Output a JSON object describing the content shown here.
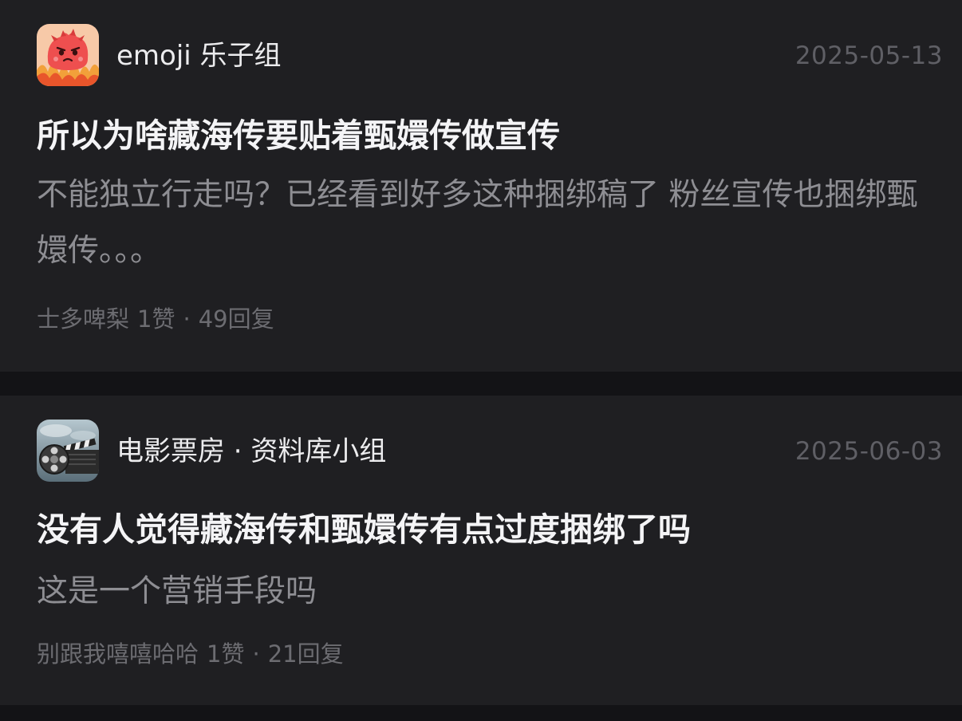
{
  "posts": [
    {
      "group": "emoji 乐子组",
      "avatar_icon": "red-fire-monster-icon",
      "date": "2025-05-13",
      "title": "所以为啥藏海传要贴着甄嬛传做宣传",
      "body": "不能独立行走吗？已经看到好多这种捆绑稿了 粉丝宣传也捆绑甄嬛传。。。",
      "author": "士多啤梨",
      "likes": "1赞",
      "separator": "·",
      "replies": "49回复"
    },
    {
      "group": "电影票房 · 资料库小组",
      "avatar_icon": "film-reel-clapperboard-icon",
      "date": "2025-06-03",
      "title": "没有人觉得藏海传和甄嬛传有点过度捆绑了吗",
      "body": "这是一个营销手段吗",
      "author": "别跟我嘻嘻哈哈",
      "likes": "1赞",
      "separator": "·",
      "replies": "21回复"
    }
  ],
  "colors": {
    "background": "#131316",
    "card": "#1f1f22",
    "title": "#f4f4f6",
    "body": "#8e8e93",
    "meta": "#6c6c71",
    "date": "#5f5f65"
  }
}
